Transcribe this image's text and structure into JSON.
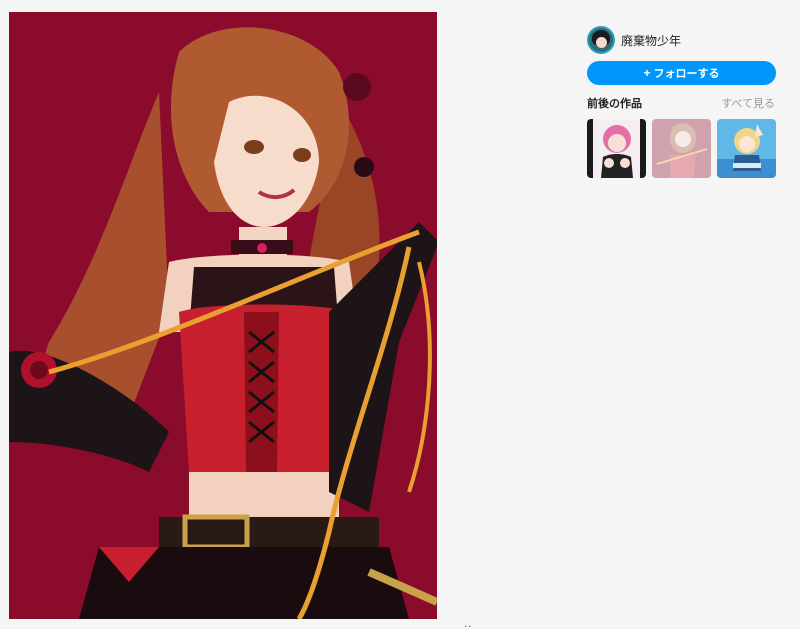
{
  "artwork": {
    "background_color": "#8a0b2c",
    "bottom_indicator": "··"
  },
  "author": {
    "name": "廃棄物少年",
    "avatar_icon": "avatar-icon"
  },
  "follow_button": {
    "label": "フォローする",
    "icon": "plus-icon",
    "color": "#0096fa"
  },
  "works": {
    "title": "前後の作品",
    "see_all": "すべて見る",
    "thumbnails": [
      {
        "name": "thumbnail-prev",
        "current": false
      },
      {
        "name": "thumbnail-current",
        "current": true
      },
      {
        "name": "thumbnail-next",
        "current": false
      }
    ]
  }
}
